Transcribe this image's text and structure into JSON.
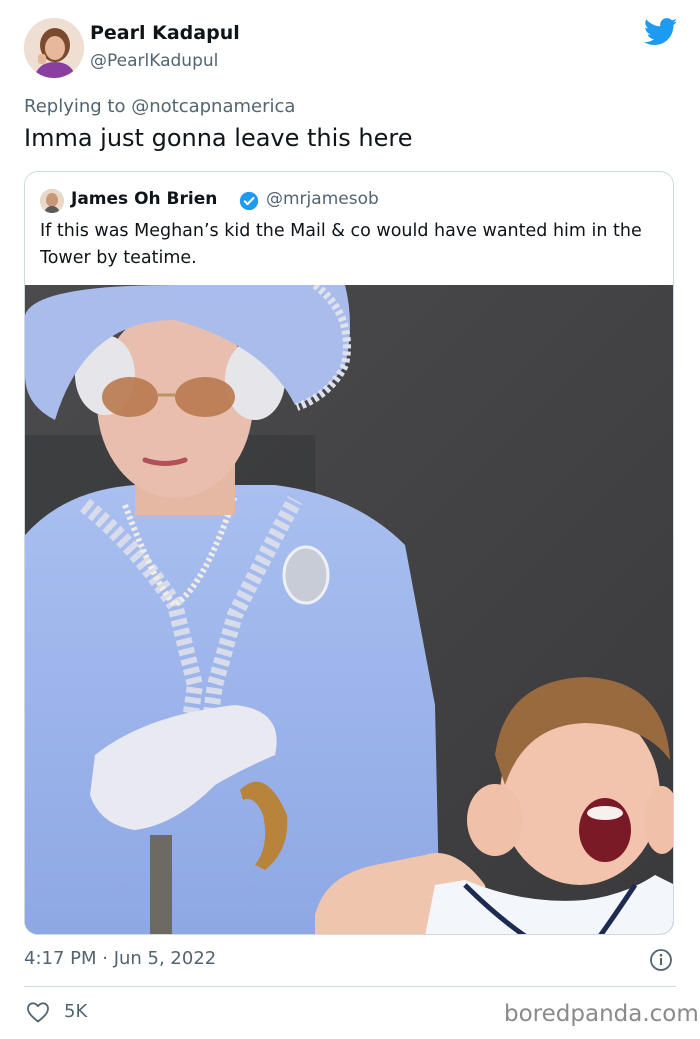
{
  "author": {
    "display_name": "Pearl Kadapul",
    "handle": "@PearlKadupul",
    "avatar_icon": "profile-photo"
  },
  "brand_icon": "twitter-bird-icon",
  "brand_color": "#1d9bf0",
  "reply": {
    "prefix": "Replying to",
    "target": "@notcapnamerica"
  },
  "tweet_text": "Imma just gonna leave this here",
  "quoted_tweet": {
    "display_name": "James Oh Brien",
    "verified": true,
    "handle": "@mrjamesob",
    "text": "If this was Meghan’s kid the Mail & co would have wanted him in the Tower by teatime.",
    "photo_alt": "photo"
  },
  "meta": {
    "timestamp": "4:17 PM · Jun 5, 2022"
  },
  "actions": {
    "like_count": "5K"
  },
  "watermark": "boredpanda.com"
}
